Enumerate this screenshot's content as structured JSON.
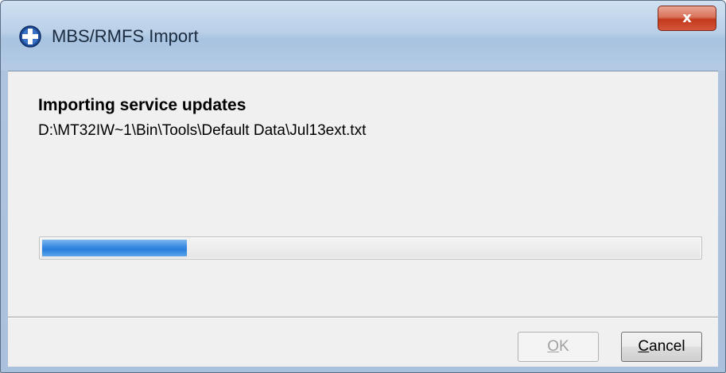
{
  "window": {
    "title": "MBS/RMFS Import",
    "app_icon": "circle-plus-icon",
    "close_glyph": "x",
    "close_icon": "close-icon"
  },
  "content": {
    "heading": "Importing service updates",
    "file_path": "D:\\MT32IW~1\\Bin\\Tools\\Default Data\\Jul13ext.txt",
    "progress_fraction": 0.22
  },
  "buttons": {
    "ok": {
      "mnemonic": "O",
      "rest": "K",
      "enabled": false
    },
    "cancel": {
      "mnemonic": "C",
      "rest": "ancel",
      "enabled": true
    }
  },
  "colors": {
    "progress_fill": "#2a7fdc",
    "close_button": "#c2391c",
    "title_bar": "#bad0e8"
  }
}
